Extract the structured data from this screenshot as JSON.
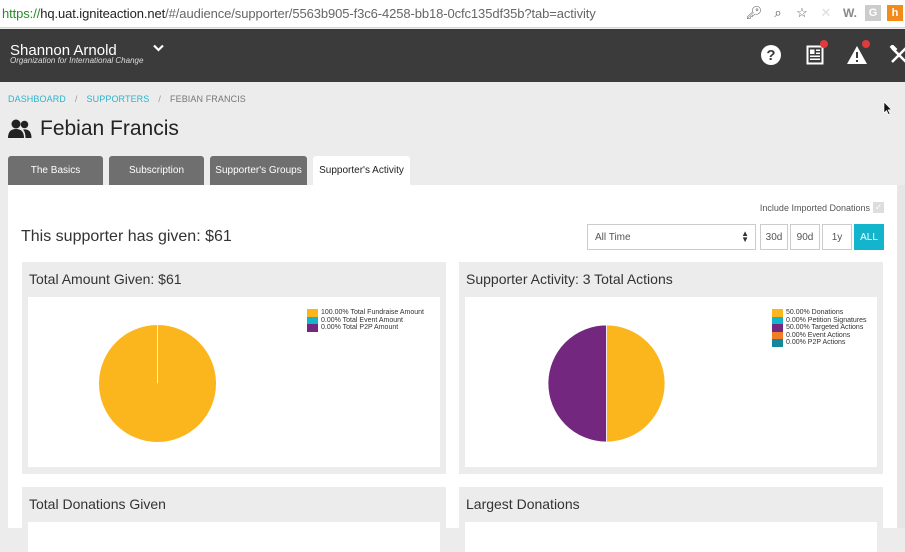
{
  "browser": {
    "url_scheme": "https://",
    "url_host": "hq.uat.igniteaction.net",
    "url_path": "/#/audience/supporter/5563b905-f3c6-4258-bb18-0cfc135df35b?tab=activity",
    "icons": [
      "key-icon",
      "zoom-icon",
      "star-icon",
      "extension-x-icon",
      "extension-w-icon",
      "extension-g-icon",
      "extension-h-icon"
    ],
    "ext_w": "W.",
    "ext_g": "G",
    "ext_h": "h"
  },
  "header": {
    "user_name": "Shannon Arnold",
    "org_name": "Organization for International Change",
    "help_glyph": "?",
    "notifications": {
      "news_badge": true,
      "alerts_badge": true
    }
  },
  "breadcrumb": [
    {
      "label": "DASHBOARD",
      "link": true
    },
    {
      "label": "SUPPORTERS",
      "link": true
    },
    {
      "label": "FEBIAN FRANCIS",
      "link": false
    }
  ],
  "breadcrumb_sep": "/",
  "page": {
    "title": "Febian Francis"
  },
  "tabs": [
    {
      "label": "The Basics",
      "active": false
    },
    {
      "label": "Subscription",
      "active": false
    },
    {
      "label": "Supporter's Groups",
      "active": false
    },
    {
      "label": "Supporter's Activity",
      "active": true
    }
  ],
  "activity": {
    "include_imported_label": "Include Imported Donations",
    "include_imported_checked": true,
    "given_text": "This supporter has given: $61",
    "period_select": "All Time",
    "range_buttons": [
      {
        "label": "30d",
        "active": false
      },
      {
        "label": "90d",
        "active": false
      },
      {
        "label": "1y",
        "active": false
      },
      {
        "label": "ALL",
        "active": true
      }
    ],
    "accent_color": "#12b5cb"
  },
  "cards": {
    "total_amount_title": "Total Amount Given: $61",
    "supporter_activity_title": "Supporter Activity: 3 Total Actions",
    "total_donations_title": "Total Donations Given",
    "largest_donations_title": "Largest Donations"
  },
  "chart_data": [
    {
      "type": "pie",
      "title": "Total Amount Given: $61",
      "legend_position": "top-right",
      "slices": [
        {
          "label": "100.00% Total Fundraise Amount",
          "value": 100.0,
          "color": "#fbb61e"
        },
        {
          "label": "0.00% Total Event Amount",
          "value": 0.0,
          "color": "#12b5cb"
        },
        {
          "label": "0.00% Total P2P Amount",
          "value": 0.0,
          "color": "#73277f"
        }
      ]
    },
    {
      "type": "pie",
      "title": "Supporter Activity: 3 Total Actions",
      "legend_position": "top-right",
      "slices": [
        {
          "label": "50.00% Donations",
          "value": 50.0,
          "color": "#fbb61e"
        },
        {
          "label": "0.00% Petition Signatures",
          "value": 0.0,
          "color": "#12b5cb"
        },
        {
          "label": "50.00% Targeted Actions",
          "value": 50.0,
          "color": "#73277f"
        },
        {
          "label": "0.00% Event Actions",
          "value": 0.0,
          "color": "#f07e26"
        },
        {
          "label": "0.00% P2P Actions",
          "value": 0.0,
          "color": "#14889a"
        }
      ]
    }
  ]
}
